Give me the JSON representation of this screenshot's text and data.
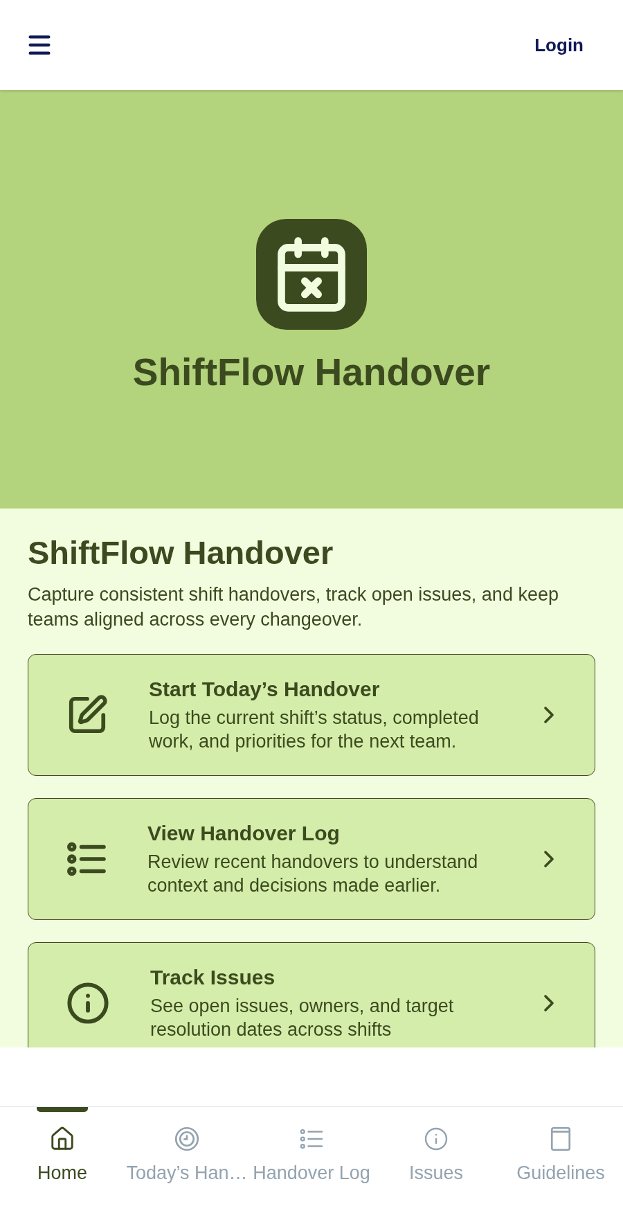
{
  "header": {
    "login": "Login"
  },
  "hero": {
    "title": "ShiftFlow Handover"
  },
  "intro": {
    "heading": "ShiftFlow Handover",
    "description": "Capture consistent shift handovers, track open issues, and keep teams aligned across every changeover."
  },
  "actions": [
    {
      "kind": "start",
      "title": "Start Today’s Handover",
      "description": "Log the current shift’s status, completed work, and priorities for the next team."
    },
    {
      "kind": "log",
      "title": "View Handover Log",
      "description": "Review recent handovers to understand context and decisions made earlier."
    },
    {
      "kind": "issues",
      "title": "Track Issues",
      "description": "See open issues, owners, and target resolution dates across shifts"
    }
  ],
  "bottom_nav": [
    {
      "kind": "home",
      "label": "Home",
      "selected": true
    },
    {
      "kind": "today",
      "label": "Today’s Han…",
      "selected": false
    },
    {
      "kind": "log",
      "label": "Handover Log",
      "selected": false
    },
    {
      "kind": "issues",
      "label": "Issues",
      "selected": false
    },
    {
      "kind": "guidelines",
      "label": "Guidelines",
      "selected": false
    }
  ]
}
